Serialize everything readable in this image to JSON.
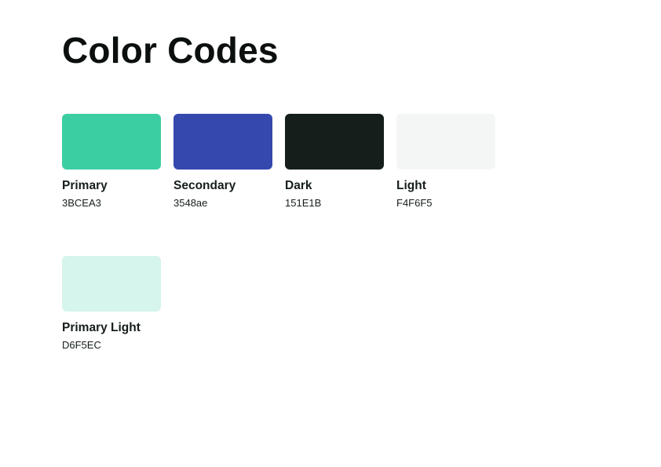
{
  "page": {
    "title": "Color Codes"
  },
  "swatches": [
    {
      "name": "Primary",
      "code": "3BCEA3",
      "color": "#3BCEA3"
    },
    {
      "name": "Secondary",
      "code": "3548ae",
      "color": "#3548ae"
    },
    {
      "name": "Dark",
      "code": "151E1B",
      "color": "#151E1B"
    },
    {
      "name": "Light",
      "code": "F4F6F5",
      "color": "#F4F6F5"
    },
    {
      "name": "Primary Light",
      "code": "D6F5EC",
      "color": "#D6F5EC"
    }
  ]
}
